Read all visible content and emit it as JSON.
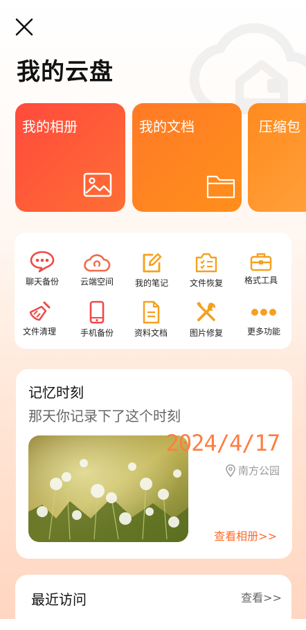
{
  "page_title": "我的云盘",
  "tiles": [
    {
      "label": "我的相册",
      "icon": "image-icon"
    },
    {
      "label": "我的文档",
      "icon": "folder-icon"
    },
    {
      "label": "压缩包",
      "icon": ""
    }
  ],
  "tools": [
    {
      "label": "聊天备份",
      "icon": "chat-bubble-icon"
    },
    {
      "label": "云端空间",
      "icon": "cloud-space-icon"
    },
    {
      "label": "我的笔记",
      "icon": "note-edit-icon"
    },
    {
      "label": "文件恢复",
      "icon": "file-recover-icon"
    },
    {
      "label": "格式工具",
      "icon": "toolbox-icon"
    },
    {
      "label": "文件清理",
      "icon": "broom-icon"
    },
    {
      "label": "手机备份",
      "icon": "phone-icon"
    },
    {
      "label": "资料文档",
      "icon": "document-icon"
    },
    {
      "label": "图片修复",
      "icon": "repair-tools-icon"
    },
    {
      "label": "更多功能",
      "icon": "more-dots-icon"
    }
  ],
  "memory": {
    "title": "记忆时刻",
    "subtitle": "那天你记录下了这个时刻",
    "date": "2024/4/17",
    "location": "南方公园",
    "link": "查看相册>>"
  },
  "recent": {
    "title": "最近访问",
    "link": "查看>>"
  },
  "colors": {
    "accent": "#ff7a26",
    "red": "#ff4a3d",
    "tool_red": "#f04848",
    "tool_orange": "#f7a325"
  }
}
